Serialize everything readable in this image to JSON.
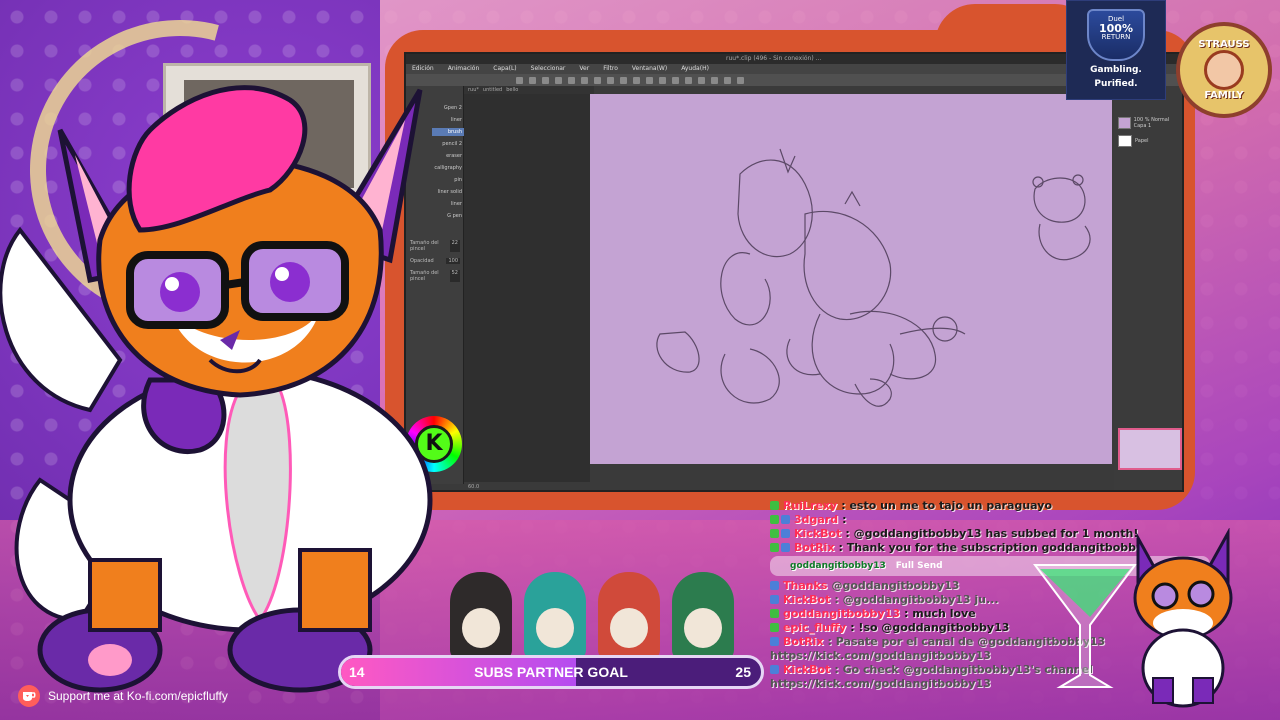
{
  "scene": {
    "colors": {
      "accent_purple": "#7d2ec5",
      "accent_pink": "#e879b4",
      "tv_frame": "#d8542e",
      "kick_green": "#53fc18"
    }
  },
  "app": {
    "title_text": "ruu*.clip (496 - Sin conexión) ...",
    "menu": [
      "Edición",
      "Animación",
      "Capa(L)",
      "Seleccionar",
      "Ver",
      "Filtro",
      "Ventana(W)",
      "Ayuda(H)"
    ],
    "brushes": [
      "Gpen 2",
      "liner",
      "brush",
      "pencil 2",
      "eraser",
      "calligraphy",
      "pin",
      "liner solid",
      "liner",
      "G pen"
    ],
    "brush_selected_index": 2,
    "properties": [
      {
        "label": "Tamaño del pincel",
        "value": "22"
      },
      {
        "label": "Opacidad",
        "value": "100"
      },
      {
        "label": "Tamaño del pincel",
        "value": "52"
      }
    ],
    "doc_tabs": [
      "ruu*",
      "untitled",
      "bello"
    ],
    "layers": [
      {
        "name": "100 % Normal Capa 1",
        "type": "layer"
      },
      {
        "name": "Papel",
        "type": "paper"
      }
    ],
    "kick_badge": "K",
    "status": "60.0"
  },
  "sponsor": {
    "line1": "Duel",
    "line2": "100%",
    "line3": "RETURN",
    "tagline1": "Gambling.",
    "tagline2": "Purified."
  },
  "family_badge": {
    "top": "STRAUSS",
    "bottom": "FAMILY"
  },
  "chat": {
    "lines": [
      {
        "user": "RuiLrexy",
        "text": ": esto un me to tajo un paraguayo",
        "user_color": "red"
      },
      {
        "user": "3dgard",
        "text": ":",
        "user_color": "red"
      },
      {
        "user": "KickBot",
        "text": ": @goddangitbobby13 has subbed for 1 month!",
        "user_color": "red"
      },
      {
        "user": "BotRix",
        "text": ": Thank you for the subscription goddangitbobby",
        "user_color": "red"
      },
      {
        "user": "Thanks",
        "text": "@goddangitbobby13",
        "user_color": "red"
      },
      {
        "user": "KickBot",
        "text": ": @goddangitbobby13 ju...",
        "user_color": "red"
      },
      {
        "user": "goddangitbobby13",
        "text": ": much love",
        "user_color": "red"
      },
      {
        "user": "epic_fluffy",
        "text": ": !so @goddangitbobby13",
        "user_color": "red"
      },
      {
        "user": "BotRix",
        "text": ": Pasate por el canal de @goddangitbobby13",
        "user_color": "red"
      },
      {
        "user": "",
        "text": "https://kick.com/goddangitbobby13",
        "user_color": "red"
      },
      {
        "user": "KickBot",
        "text": ": Go check @goddangitbobby13's channel",
        "user_color": "red"
      },
      {
        "user": "",
        "text": "https://kick.com/goddangitbobby13",
        "user_color": "red"
      }
    ],
    "send_user": "goddangitbobby13",
    "send_label": "Full Send"
  },
  "goal": {
    "title": "SUBS PARTNER GOAL",
    "current": "14",
    "target": "25",
    "progress": 0.56
  },
  "kofi": {
    "text": "Support me at Ko-fi.com/epicfluffy"
  }
}
